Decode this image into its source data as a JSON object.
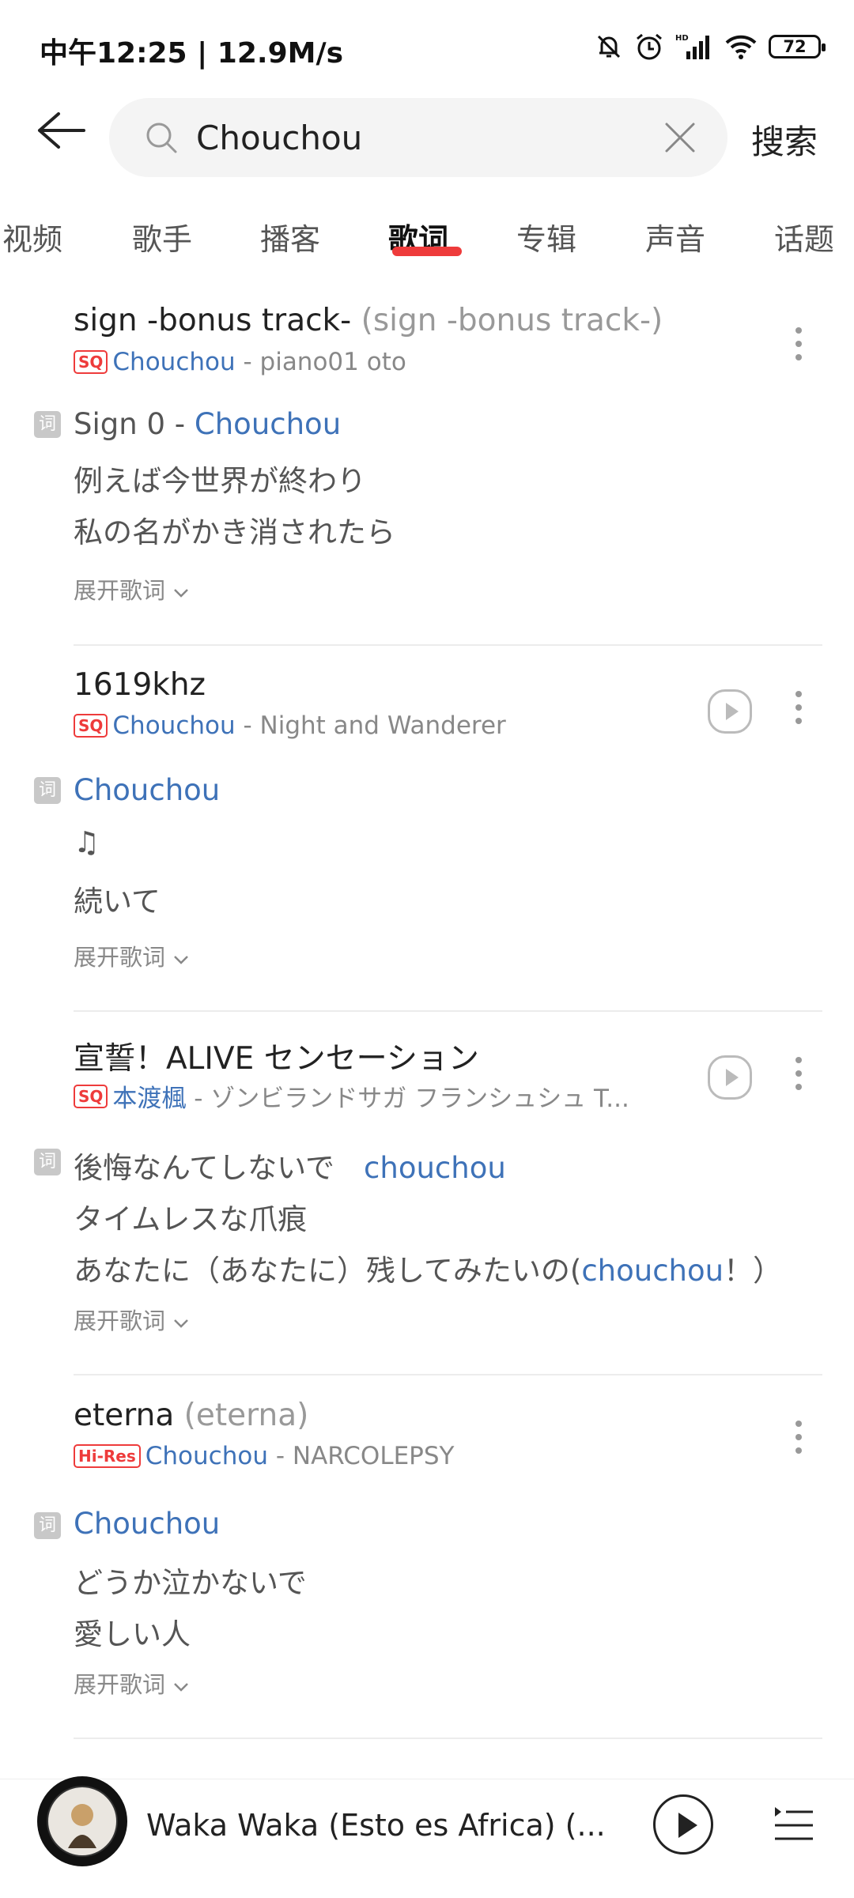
{
  "status_bar": {
    "time": "中午12:25 | 12.9M/s",
    "battery": "72"
  },
  "search": {
    "query": "Chouchou",
    "button": "搜索"
  },
  "tabs": [
    "视频",
    "歌手",
    "播客",
    "歌词",
    "专辑",
    "声音",
    "话题"
  ],
  "active_tab": "歌词",
  "results": [
    {
      "title": "sign -bonus track-",
      "alt_title": "(sign  -bonus track-)",
      "badge": "SQ",
      "artist": "Chouchou",
      "album": "- piano01 oto",
      "lyric_badge": "词",
      "lyrics": [
        {
          "pre": "Sign 0 - ",
          "hl": "Chouchou",
          "post": ""
        },
        {
          "pre": "例えば今世界が終わり",
          "hl": "",
          "post": ""
        },
        {
          "pre": "私の名がかき消されたら",
          "hl": "",
          "post": ""
        }
      ],
      "expand": "展开歌词"
    },
    {
      "title": "1619khz",
      "alt_title": "",
      "badge": "SQ",
      "artist": "Chouchou",
      "album": "- Night and Wanderer",
      "lyric_badge": "词",
      "lyrics": [
        {
          "pre": "",
          "hl": "Chouchou",
          "post": ""
        },
        {
          "pre": "♫",
          "hl": "",
          "post": ""
        },
        {
          "pre": "続いて",
          "hl": "",
          "post": ""
        }
      ],
      "expand": "展开歌词"
    },
    {
      "title": "宣誓！ALIVE センセーション",
      "alt_title": "",
      "badge": "SQ",
      "artist": "本渡楓",
      "album": "- ゾンビランドサガ フランシュシュ T...",
      "lyric_badge": "词",
      "lyrics": [
        {
          "pre": "後悔なんてしないで　",
          "hl": "chouchou",
          "post": ""
        },
        {
          "pre": "タイムレスな爪痕",
          "hl": "",
          "post": ""
        },
        {
          "pre": "あなたに（あなたに）残してみたいの(",
          "hl": "chouchou",
          "post": "！）"
        }
      ],
      "expand": "展开歌词"
    },
    {
      "title": "eterna",
      "alt_title": "(eterna)",
      "badge": "Hi-Res",
      "artist": "Chouchou",
      "album": "- NARCOLEPSY",
      "lyric_badge": "词",
      "lyrics": [
        {
          "pre": "",
          "hl": "Chouchou",
          "post": ""
        },
        {
          "pre": "どうか泣かないで",
          "hl": "",
          "post": ""
        },
        {
          "pre": "愛しい人",
          "hl": "",
          "post": ""
        }
      ],
      "expand": "展开歌词"
    }
  ],
  "player": {
    "title": "Waka Waka (Esto es Africa) (..."
  },
  "colors": {
    "accent": "#ee3b3b",
    "link": "#3e72b8"
  }
}
